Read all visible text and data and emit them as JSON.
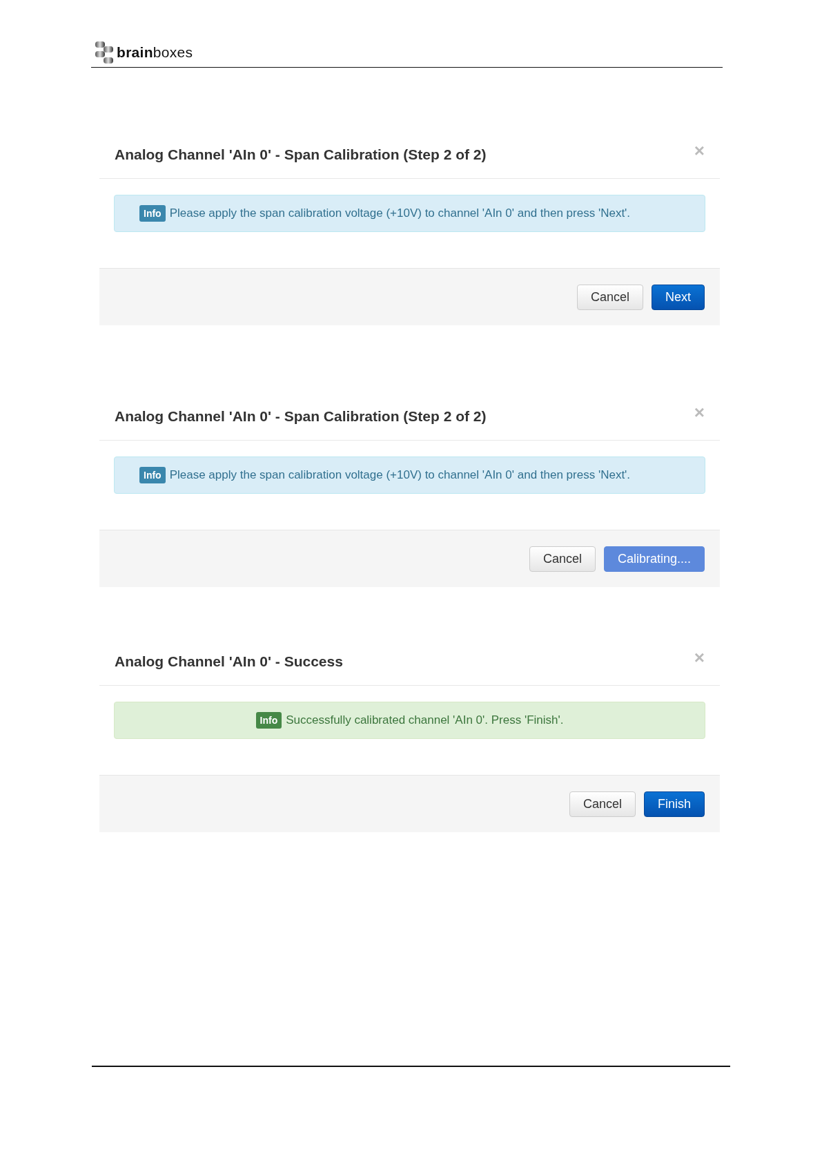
{
  "header": {
    "logo": "**brain**boxes"
  },
  "dialogs": [
    {
      "title": "Analog Channel 'AIn 0' - Span Calibration (Step 2 of 2)",
      "close": "×",
      "alert": {
        "kind": "info",
        "badge": "Info",
        "text": "Please apply the span calibration voltage (+10V) to channel 'AIn 0' and then press 'Next'."
      },
      "buttons": [
        {
          "label": "Cancel",
          "kind": "default",
          "disabled": false
        },
        {
          "label": "Next",
          "kind": "primary",
          "disabled": false
        }
      ]
    },
    {
      "title": "Analog Channel 'AIn 0' - Span Calibration (Step 2 of 2)",
      "close": "×",
      "alert": {
        "kind": "info",
        "badge": "Info",
        "text": "Please apply the span calibration voltage (+10V) to channel 'AIn 0' and then press 'Next'."
      },
      "buttons": [
        {
          "label": "Cancel",
          "kind": "default",
          "disabled": false
        },
        {
          "label": "Calibrating....",
          "kind": "primary",
          "disabled": true
        }
      ]
    },
    {
      "title": "Analog Channel 'AIn 0' - Success",
      "close": "×",
      "alert": {
        "kind": "success",
        "badge": "Info",
        "text": "Successfully calibrated channel 'AIn 0'. Press 'Finish'."
      },
      "buttons": [
        {
          "label": "Cancel",
          "kind": "default",
          "disabled": false
        },
        {
          "label": "Finish",
          "kind": "primary",
          "disabled": false
        }
      ]
    }
  ]
}
